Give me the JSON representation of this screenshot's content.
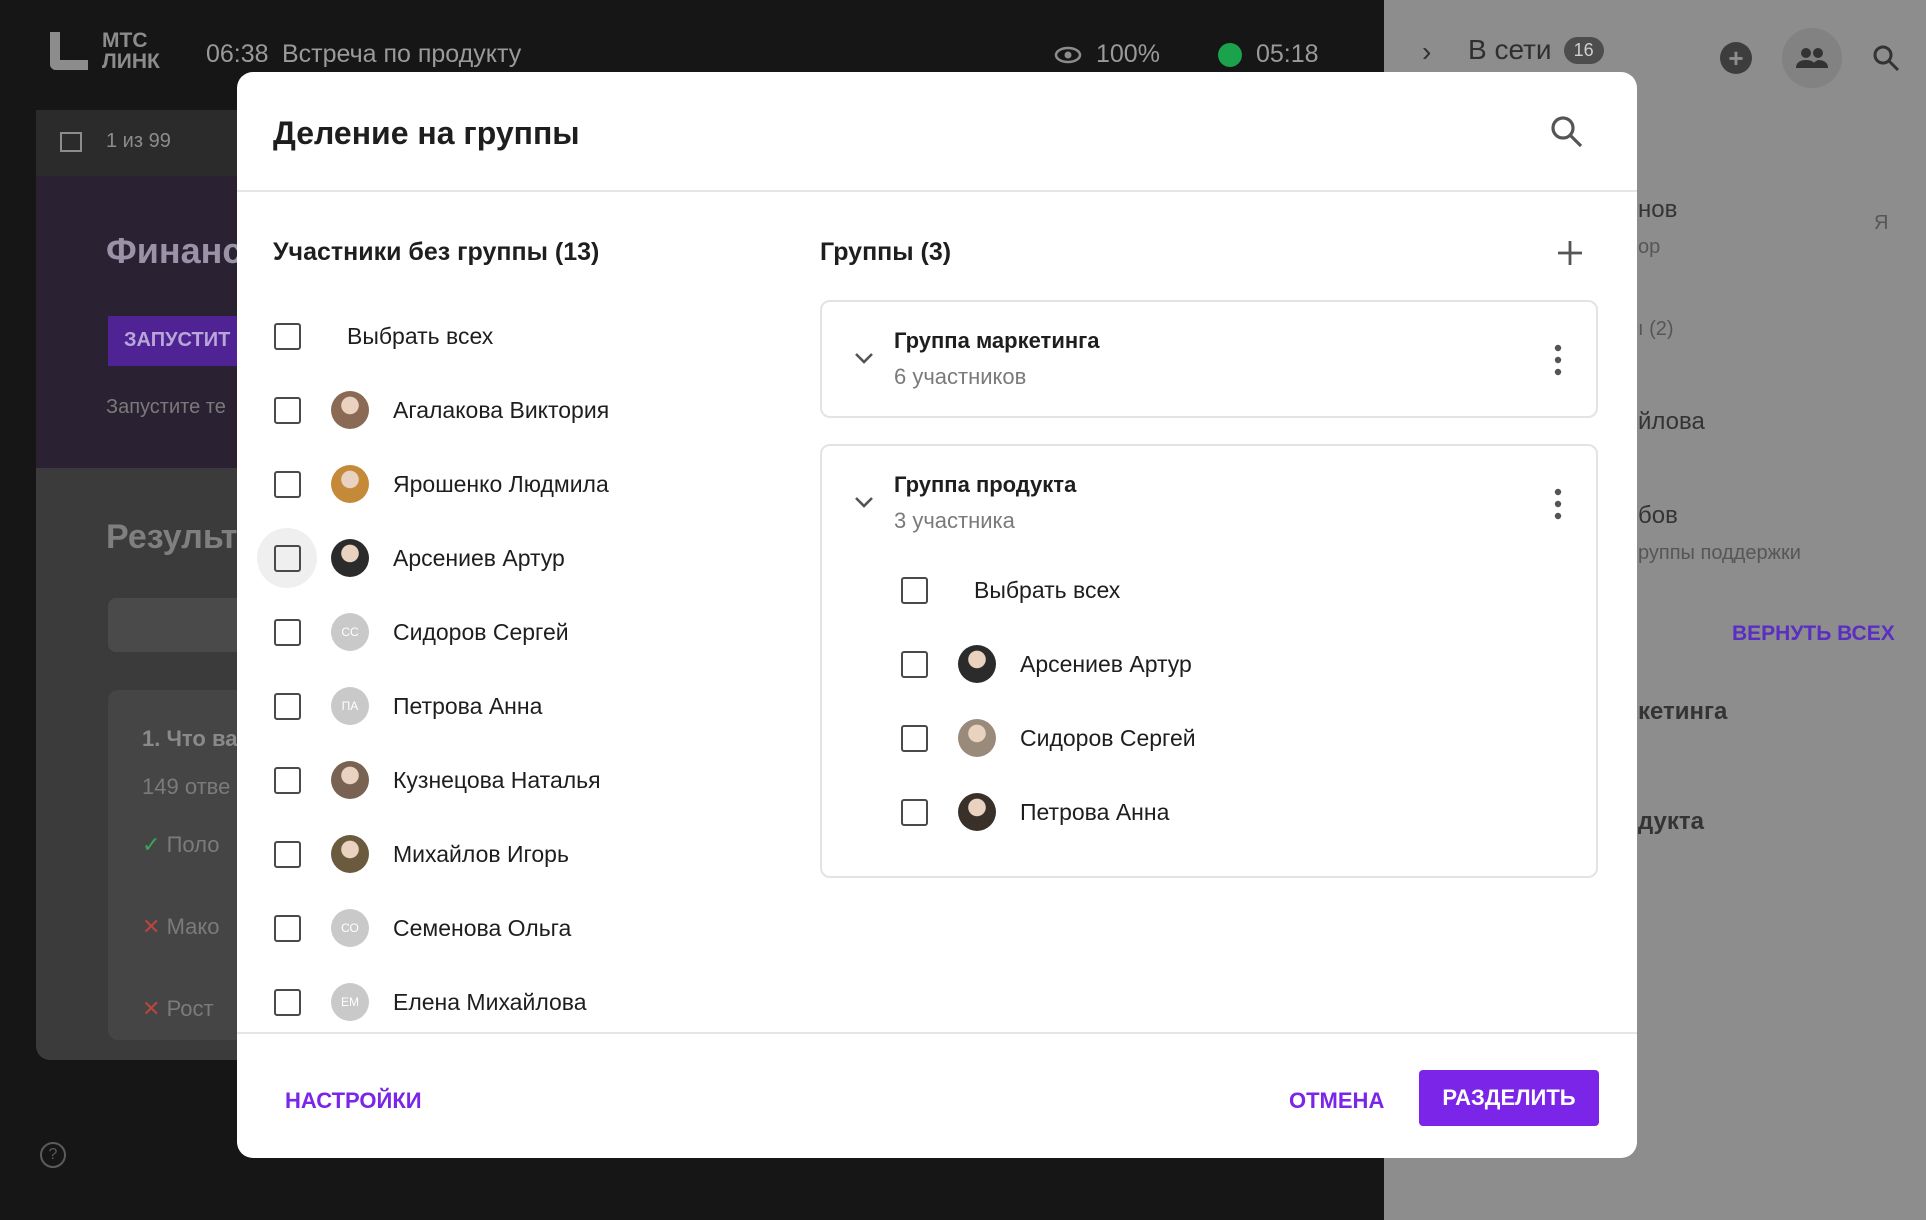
{
  "app": {
    "logo_line1": "МТС",
    "logo_line2": "ЛИНК",
    "time": "06:38",
    "meeting_title": "Встреча по продукту",
    "view_percent": "100%",
    "timer": "05:18"
  },
  "background": {
    "pager": "1 из 99",
    "presentation_title": "Финанс",
    "launch_button": "ЗАПУСТИТ",
    "launch_hint": "Запустите те",
    "results_title": "Результ",
    "question": "1. Что ва",
    "answers_count": "149 отве",
    "answer_1": "Поло",
    "answer_2": "Мако",
    "answer_3": "Рост",
    "help": "?"
  },
  "sidebar": {
    "online_label": "В сети",
    "online_count": "16",
    "frag_1": "нов",
    "frag_1_sub": "ор",
    "frag_me": "Я",
    "frag_2": "ı (2)",
    "frag_3": "йлова",
    "frag_4": "бов",
    "frag_4_sub": "руппы поддержки",
    "return_all": "ВЕРНУТЬ ВСЕХ",
    "frag_5": "кетинга",
    "frag_6": "дукта"
  },
  "modal": {
    "title": "Деление на группы",
    "ungrouped_title": "Участники без группы (13)",
    "select_all": "Выбрать всех",
    "ungrouped": [
      {
        "name": "Агалакова Виктория",
        "avatar": "photo",
        "color": "#8a6a55"
      },
      {
        "name": "Ярошенко Людмила",
        "avatar": "photo",
        "color": "#c48a3a"
      },
      {
        "name": "Арсениев Артур",
        "avatar": "photo",
        "color": "#2b2b2b"
      },
      {
        "name": "Сидоров Сергей",
        "avatar": "initials",
        "initials": "СС"
      },
      {
        "name": "Петрова Анна",
        "avatar": "initials",
        "initials": "ПА"
      },
      {
        "name": "Кузнецова Наталья",
        "avatar": "photo",
        "color": "#7a6252"
      },
      {
        "name": "Михайлов Игорь",
        "avatar": "photo",
        "color": "#6b5a3e"
      },
      {
        "name": "Семенова Ольга",
        "avatar": "initials",
        "initials": "СО"
      },
      {
        "name": "Елена Михайлова",
        "avatar": "initials",
        "initials": "ЕМ"
      }
    ],
    "groups_title": "Группы (3)",
    "groups": [
      {
        "name": "Группа маркетинга",
        "count": "6 участников"
      },
      {
        "name": "Группа продукта",
        "count": "3 участника",
        "select_all": "Выбрать всех",
        "members": [
          {
            "name": "Арсениев Артур",
            "color": "#2b2b2b"
          },
          {
            "name": "Сидоров Сергей",
            "color": "#9a8a7a"
          },
          {
            "name": "Петрова Анна",
            "color": "#3a302a"
          }
        ]
      }
    ],
    "settings_button": "НАСТРОЙКИ",
    "cancel_button": "ОТМЕНА",
    "split_button": "РАЗДЕЛИТЬ"
  },
  "colors": {
    "accent": "#7a25e8",
    "overlay_dark": "#161616",
    "sidebar_bg": "#8d8d8d"
  },
  "icons": [
    "search-icon",
    "plus-icon",
    "chevron-down-icon",
    "more-vertical-icon",
    "eye-icon",
    "timer-icon",
    "people-icon",
    "sidebar-toggle-icon",
    "help-icon"
  ]
}
